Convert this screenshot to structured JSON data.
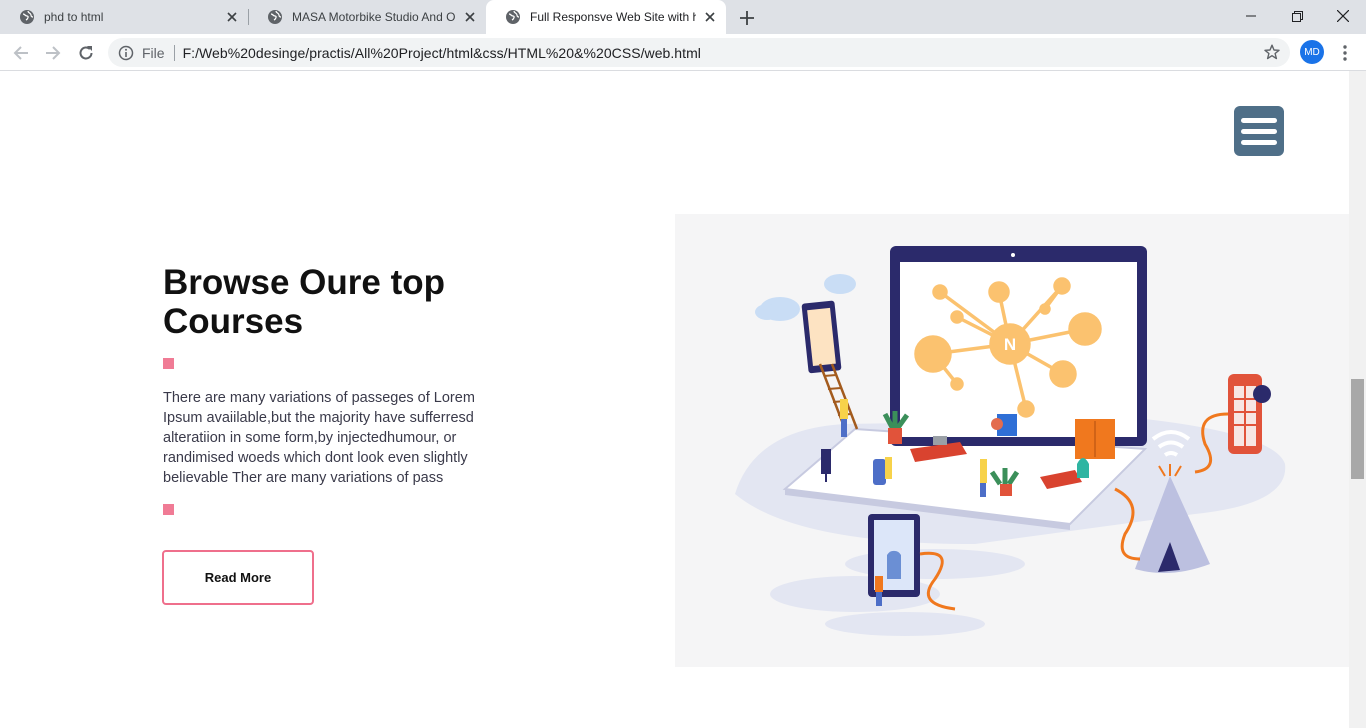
{
  "browser": {
    "tabs": [
      {
        "title": "phd to html",
        "active": false
      },
      {
        "title": "MASA Motorbike Studio And Onl",
        "active": false
      },
      {
        "title": "Full Responsve Web Site with htm",
        "active": true
      }
    ],
    "address": {
      "scheme_label": "File",
      "url": "F:/Web%20desinge/practis/All%20Project/html&css/HTML%20&%20CSS/web.html"
    },
    "profile_initials": "MD"
  },
  "page": {
    "heading": "Browse Oure top Courses",
    "body": "There are many variations of passeges of Lorem Ipsum avaiilable,but the majority have sufferresd alteratiion in some form,by injectedhumour, or randimised woeds which dont look even slightly believable Ther are many variations of pass",
    "button_label": "Read More",
    "illustration_badge": "N"
  },
  "colors": {
    "accent_pink": "#f07b95",
    "menu_button": "#4f6f88",
    "illustration_orange": "#fbc26f",
    "illustration_navy": "#2b2a6b"
  }
}
